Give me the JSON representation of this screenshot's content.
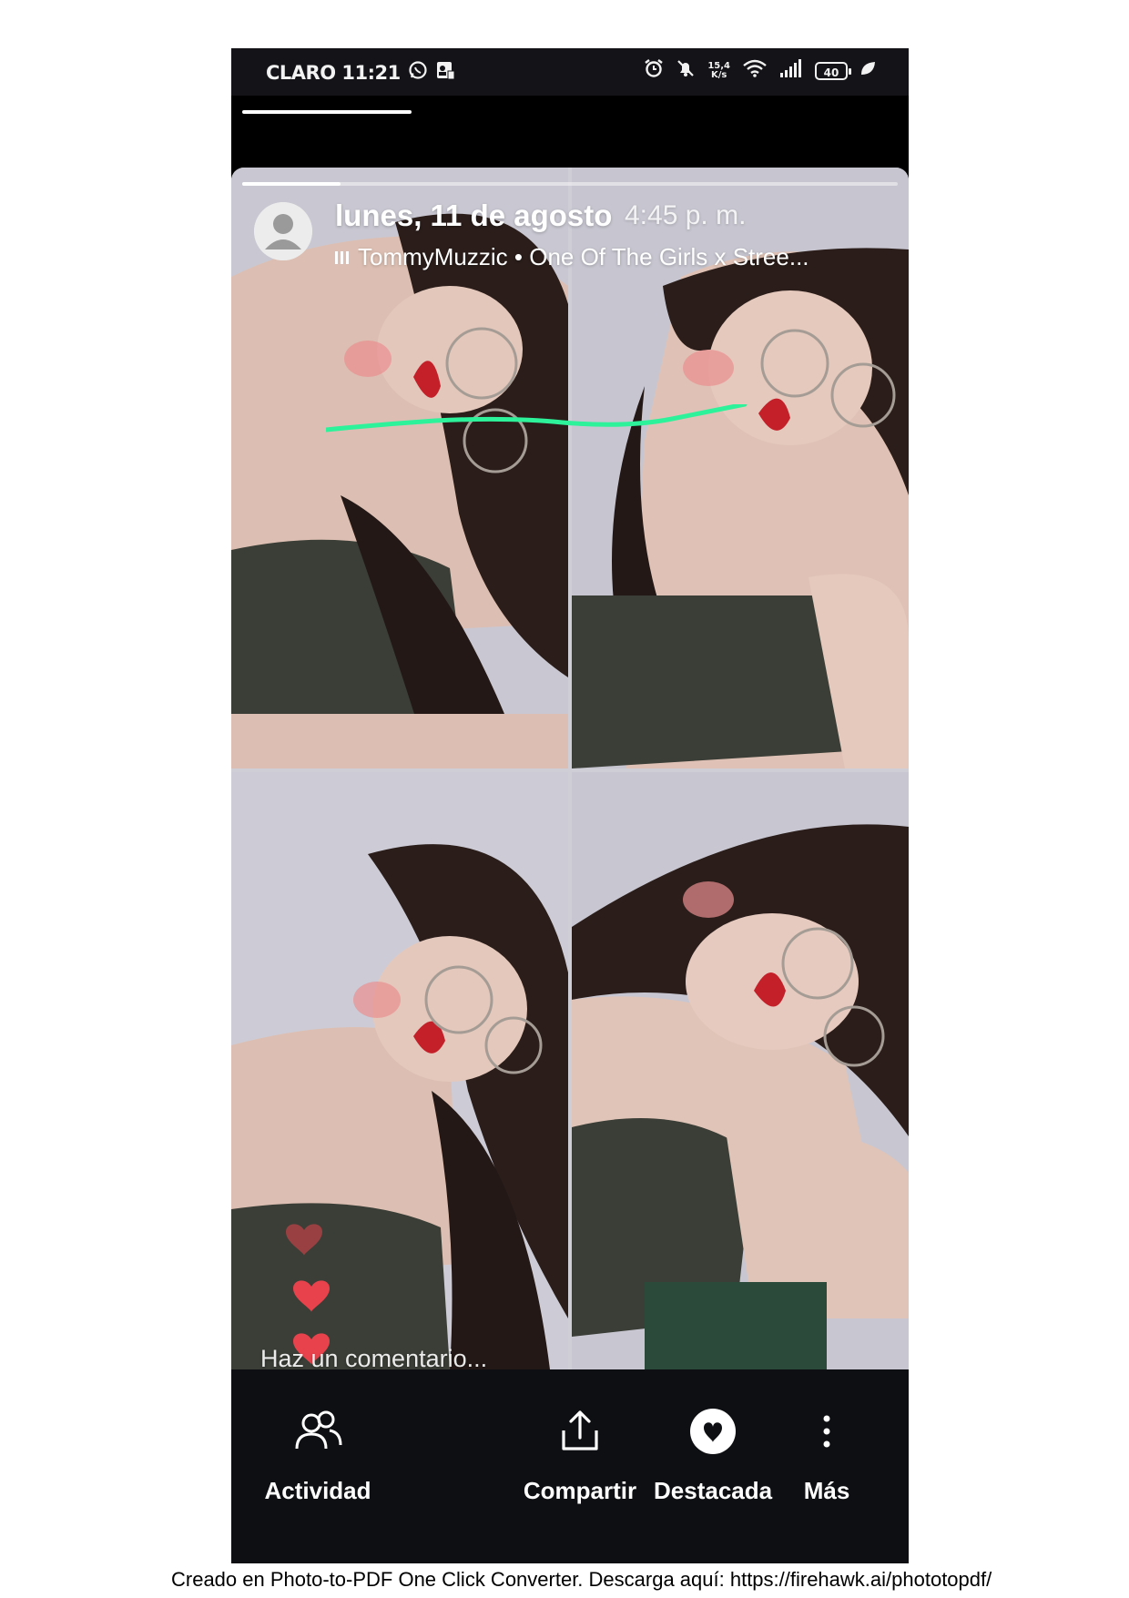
{
  "status_bar": {
    "carrier_time": "CLARO 11:21",
    "net_speed_value": "15,4",
    "net_speed_unit": "K/s",
    "battery": "40"
  },
  "story": {
    "date": "lunes, 11 de agosto",
    "time": "4:45 p. m.",
    "music": "TommyMuzzic • One Of The Girls x Stree...",
    "story_progress": 0.15,
    "comment_placeholder": "Haz un comentario..."
  },
  "actions": {
    "actividad": "Actividad",
    "compartir": "Compartir",
    "destacada": "Destacada",
    "mas": "Más"
  },
  "footer": "Creado en Photo-to-PDF One Click Converter. Descarga aquí: https://firehawk.ai/phototopdf/",
  "colors": {
    "accent_green": "#2ef29a",
    "heart_red": "#e8434c",
    "bar_bg": "#0e0f12"
  },
  "icons": [
    "whatsapp-icon",
    "contact-icon",
    "alarm-icon",
    "mute-icon",
    "wifi-icon",
    "signal-icon",
    "battery-icon",
    "leaf-icon",
    "avatar-placeholder-icon",
    "music-bars-icon",
    "heart-icon",
    "people-icon",
    "share-icon",
    "heart-filled-icon",
    "more-vertical-icon"
  ]
}
